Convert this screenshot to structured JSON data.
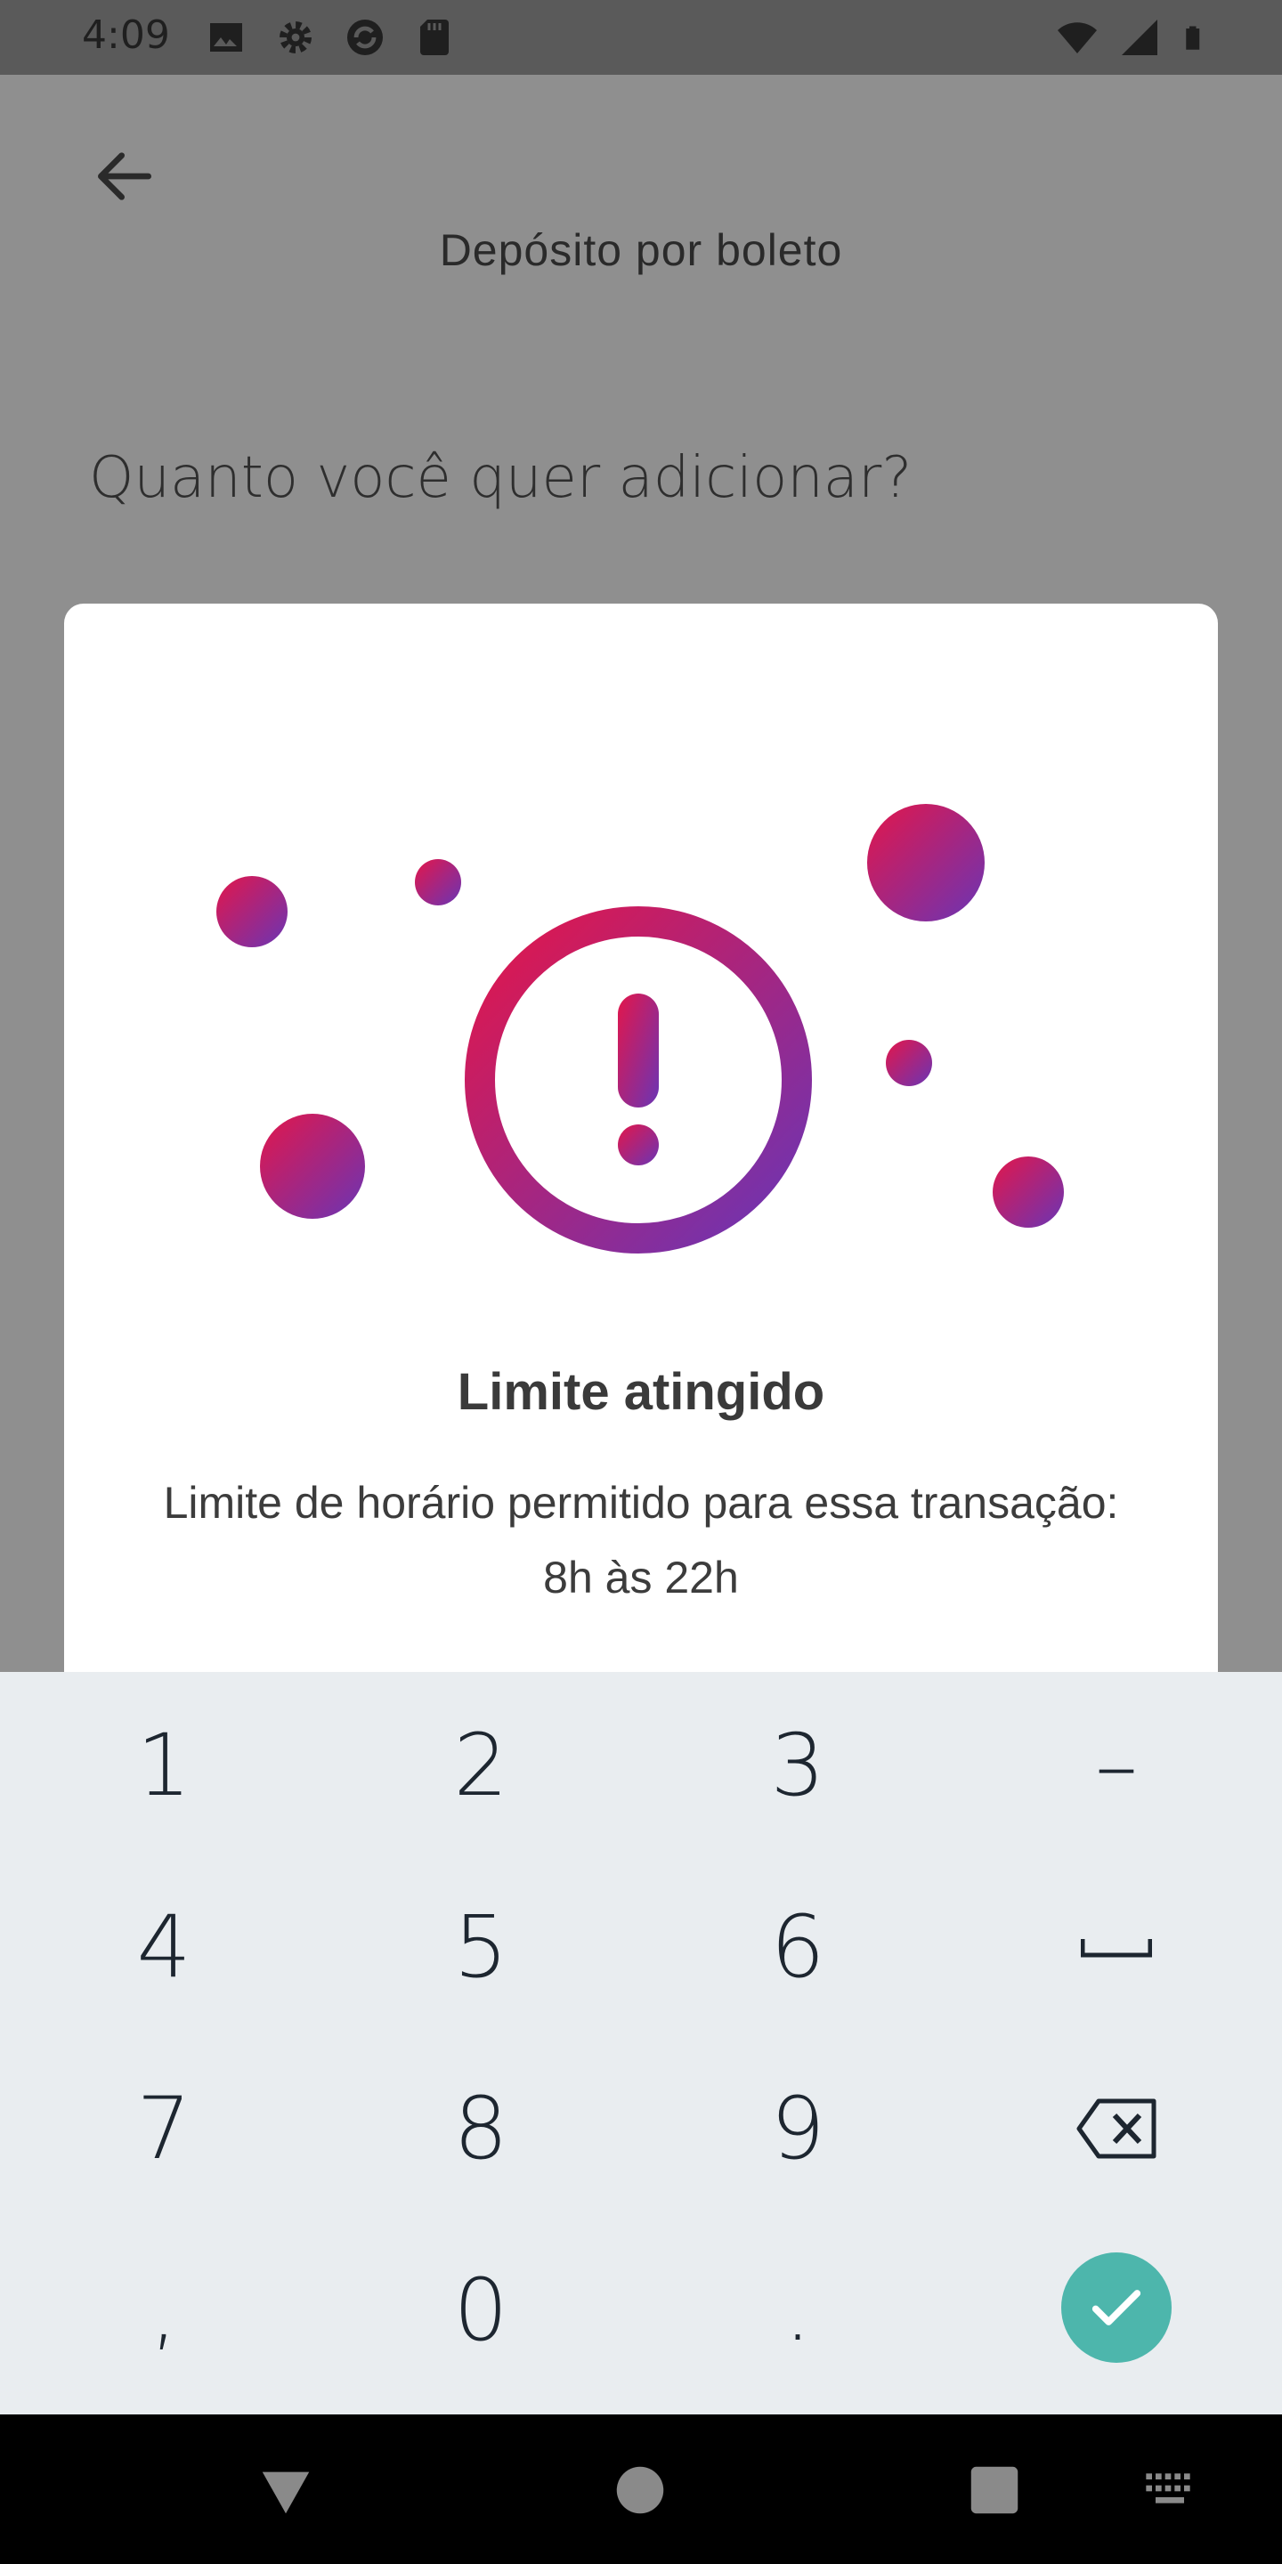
{
  "status_bar": {
    "time": "4:09",
    "icons_left": [
      "image-icon",
      "gear-icon",
      "sync-icon",
      "sd-card-icon"
    ],
    "icons_right": [
      "wifi-icon",
      "signal-icon",
      "battery-icon"
    ]
  },
  "header": {
    "title": "Depósito por boleto",
    "back_icon": "back-arrow-icon"
  },
  "main": {
    "question": "Quanto você quer adicionar?"
  },
  "dialog": {
    "illustration": "alert-illustration",
    "title": "Limite atingido",
    "message": "Limite de horário permitido para essa transação: 8h às 22h",
    "gradient_start": "#e3164a",
    "gradient_end": "#6a35b5"
  },
  "keypad": {
    "keys": [
      "1",
      "2",
      "3",
      "–",
      "4",
      "5",
      "6",
      "7",
      "8",
      "9",
      ",",
      "0",
      "."
    ],
    "space_icon": "space-icon",
    "backspace_icon": "backspace-icon",
    "confirm_icon": "check-icon",
    "confirm_color": "#4db6ac",
    "background": "#e9edf0"
  },
  "nav_bar": {
    "items": [
      "back-triangle-icon",
      "home-circle-icon",
      "recents-square-icon",
      "keyboard-icon"
    ]
  }
}
